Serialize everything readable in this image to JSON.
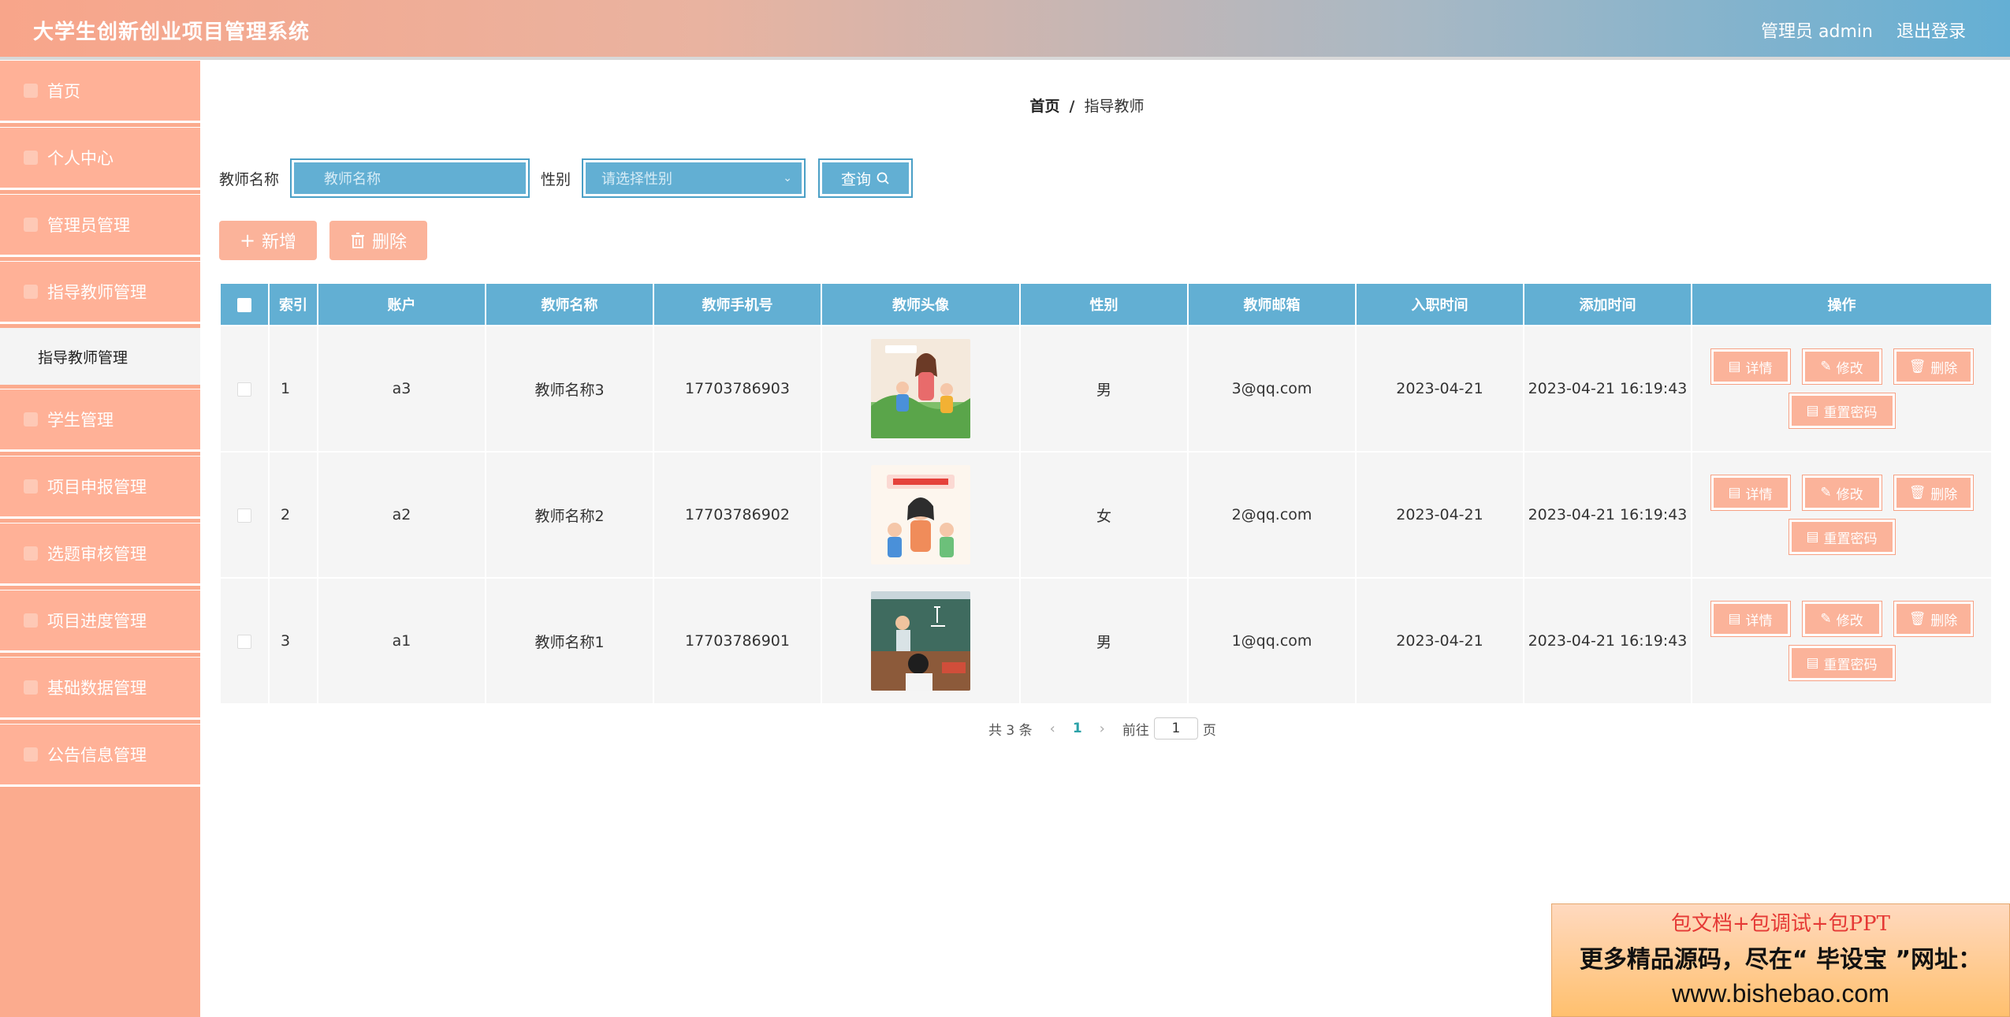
{
  "header": {
    "title": "大学生创新创业项目管理系统",
    "user": "管理员 admin",
    "logout": "退出登录"
  },
  "sidebar": {
    "items": [
      {
        "label": "首页"
      },
      {
        "label": "个人中心"
      },
      {
        "label": "管理员管理"
      },
      {
        "label": "指导教师管理"
      },
      {
        "label": "学生管理"
      },
      {
        "label": "项目申报管理"
      },
      {
        "label": "选题审核管理"
      },
      {
        "label": "项目进度管理"
      },
      {
        "label": "基础数据管理"
      },
      {
        "label": "公告信息管理"
      }
    ],
    "submenu": {
      "label": "指导教师管理"
    }
  },
  "breadcrumb": {
    "home": "首页",
    "sep": "/",
    "current": "指导教师"
  },
  "search": {
    "name_label": "教师名称",
    "name_placeholder": "教师名称",
    "gender_label": "性别",
    "gender_placeholder": "请选择性别",
    "query_label": "查询"
  },
  "actions": {
    "add": "新增",
    "delete": "删除"
  },
  "table": {
    "headers": [
      "索引",
      "账户",
      "教师名称",
      "教师手机号",
      "教师头像",
      "性别",
      "教师邮箱",
      "入职时间",
      "添加时间",
      "操作"
    ],
    "rows": [
      {
        "index": "1",
        "account": "a3",
        "name": "教师名称3",
        "phone": "17703786903",
        "gender": "男",
        "email": "3@qq.com",
        "hire": "2023-04-21",
        "added": "2023-04-21 16:19:43"
      },
      {
        "index": "2",
        "account": "a2",
        "name": "教师名称2",
        "phone": "17703786902",
        "gender": "女",
        "email": "2@qq.com",
        "hire": "2023-04-21",
        "added": "2023-04-21 16:19:43"
      },
      {
        "index": "3",
        "account": "a1",
        "name": "教师名称1",
        "phone": "17703786901",
        "gender": "男",
        "email": "1@qq.com",
        "hire": "2023-04-21",
        "added": "2023-04-21 16:19:43"
      }
    ],
    "ops": {
      "detail": "详情",
      "edit": "修改",
      "delete": "删除",
      "reset": "重置密码"
    }
  },
  "pager": {
    "total": "共 3 条",
    "current": "1",
    "goto": "前往",
    "page_value": "1",
    "page_unit": "页"
  },
  "ad": {
    "line1": "包文档+包调试+包PPT",
    "line2": "更多精品源码，尽在“ 毕设宝 ”网址：",
    "line3": "www.bishebao.com"
  },
  "colors": {
    "header_start": "#f8a58a",
    "header_end": "#64afd4",
    "sidebar": "#ffb197",
    "accent_blue": "#62afd3",
    "accent_pink": "#fbb39a"
  }
}
